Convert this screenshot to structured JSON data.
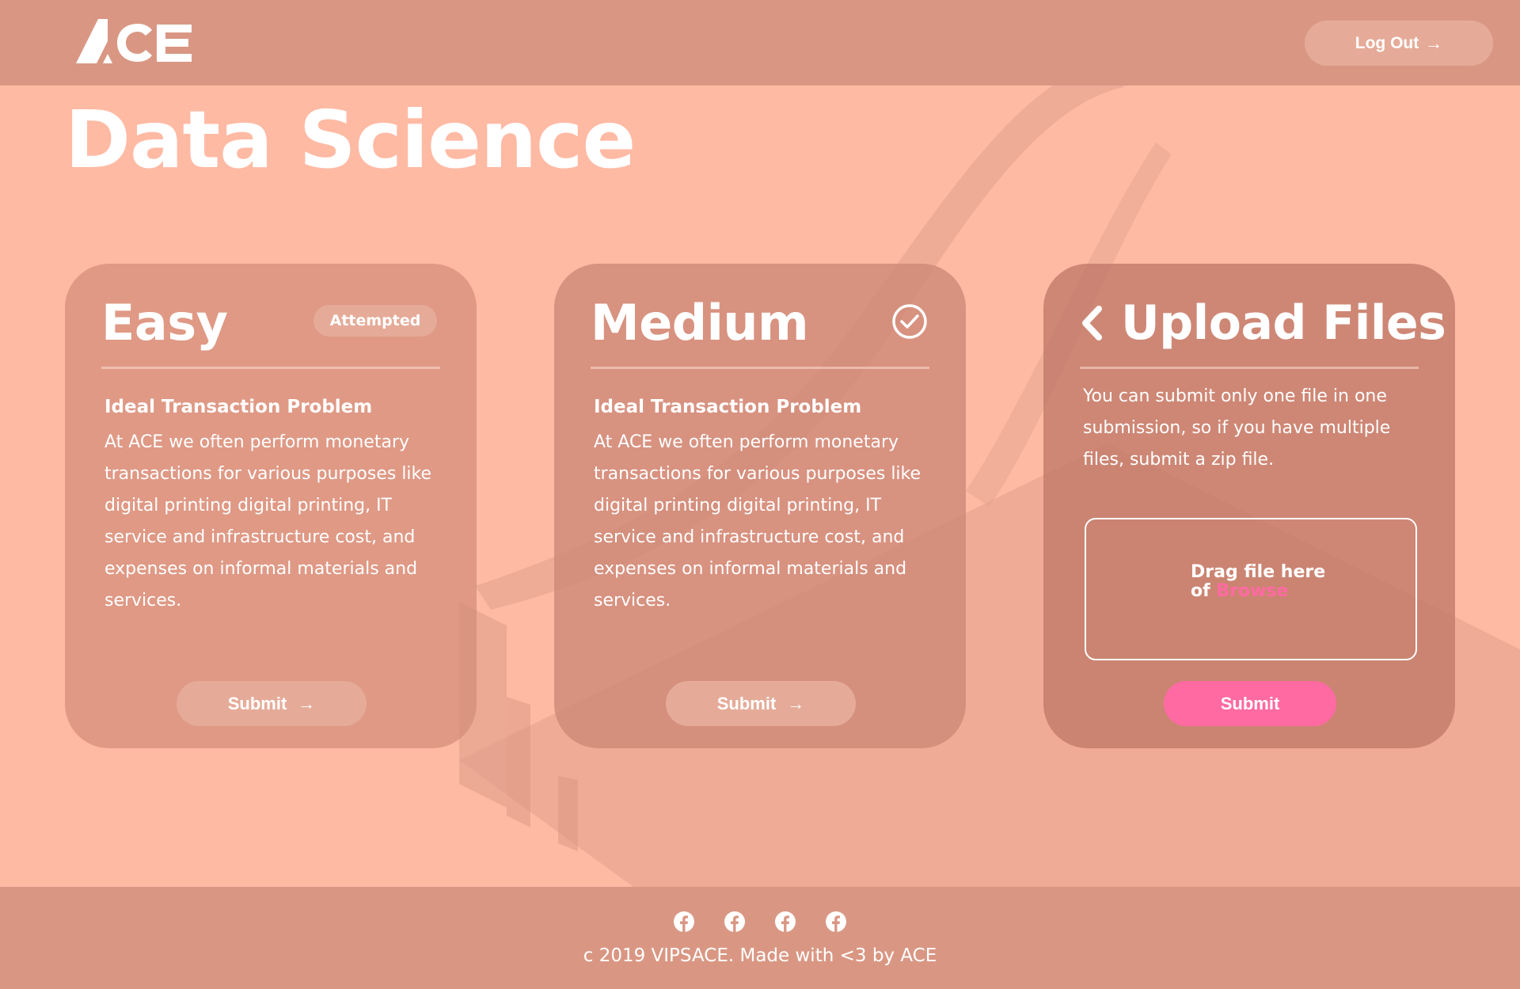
{
  "header": {
    "logo_text": "ACE",
    "logout_label": "Log Out",
    "logout_icon": "arrow-right-icon"
  },
  "page": {
    "title": "Data Science"
  },
  "cards": {
    "easy": {
      "level": "Easy",
      "status_badge": "Attempted",
      "problem_title": "Ideal Transaction Problem",
      "problem_desc": "At ACE we often perform monetary transactions for various purposes like digital printing digital printing, IT service and infrastructure cost, and expenses on informal materials and services.",
      "submit_label": "Submit"
    },
    "medium": {
      "level": "Medium",
      "status_icon": "check-circle-icon",
      "problem_title": "Ideal Transaction Problem",
      "problem_desc": "At ACE we often perform monetary transactions for various purposes like digital printing digital printing, IT service and infrastructure cost, and expenses on informal materials and services.",
      "submit_label": "Submit"
    },
    "upload": {
      "title": "Upload Files",
      "info": "You can submit only one file in one submission, so if you have multiple files, submit a zip file.",
      "drop_line1": "Drag file here",
      "drop_of": "of",
      "browse_label": "Browse",
      "submit_label": "Submit"
    }
  },
  "footer": {
    "social_icons": [
      "facebook-icon",
      "facebook-icon",
      "facebook-icon",
      "facebook-icon"
    ],
    "copyright": "c 2019 VIPSACE. Made with <3 by ACE"
  },
  "colors": {
    "background": "#ffbaa4",
    "header_footer": "#d99783",
    "button_muted": "#e5ab98",
    "accent_pink": "#ff6aa2"
  }
}
